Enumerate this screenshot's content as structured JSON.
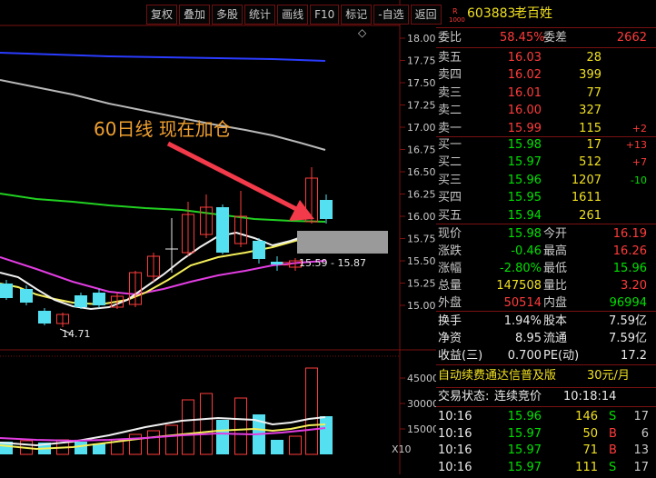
{
  "toolbar": {
    "buttons": [
      "复权",
      "叠加",
      "多股",
      "统计",
      "画线",
      "F10",
      "标记",
      "-自选",
      "返回"
    ]
  },
  "price_axis": [
    "18.00",
    "17.75",
    "17.50",
    "17.25",
    "17.00",
    "16.75",
    "16.50",
    "16.25",
    "16.00",
    "15.75",
    "15.50",
    "15.25",
    "15.00"
  ],
  "volume_axis": [
    "45000",
    "30000",
    "15000"
  ],
  "volume_unit": "X10",
  "chart": {
    "annotation": "60日线  现在加仓",
    "range_label": "15.59 - 15.87",
    "low_label": "14.71",
    "diamond": "◇"
  },
  "stock": {
    "badge_r": "R",
    "badge_num": "1000",
    "code": "603883",
    "name": "老百姓"
  },
  "order_ratio": {
    "label1": "委比",
    "value1": "58.45%",
    "label2": "委差",
    "value2": "2662"
  },
  "asks": [
    {
      "label": "卖五",
      "price": "16.03",
      "vol": "28",
      "chg": ""
    },
    {
      "label": "卖四",
      "price": "16.02",
      "vol": "399",
      "chg": ""
    },
    {
      "label": "卖三",
      "price": "16.01",
      "vol": "77",
      "chg": ""
    },
    {
      "label": "卖二",
      "price": "16.00",
      "vol": "327",
      "chg": ""
    },
    {
      "label": "卖一",
      "price": "15.99",
      "vol": "115",
      "chg": "+2"
    }
  ],
  "bids": [
    {
      "label": "买一",
      "price": "15.98",
      "vol": "17",
      "chg": "+13"
    },
    {
      "label": "买二",
      "price": "15.97",
      "vol": "512",
      "chg": "+7"
    },
    {
      "label": "买三",
      "price": "15.96",
      "vol": "1207",
      "chg": "-10"
    },
    {
      "label": "买四",
      "price": "15.95",
      "vol": "1611",
      "chg": ""
    },
    {
      "label": "买五",
      "price": "15.94",
      "vol": "261",
      "chg": ""
    }
  ],
  "quote": [
    {
      "l1": "现价",
      "v1": "15.98",
      "c1": "green",
      "l2": "今开",
      "v2": "16.19",
      "c2": "red"
    },
    {
      "l1": "涨跌",
      "v1": "-0.46",
      "c1": "green",
      "l2": "最高",
      "v2": "16.26",
      "c2": "red"
    },
    {
      "l1": "涨幅",
      "v1": "-2.80%",
      "c1": "green",
      "l2": "最低",
      "v2": "15.96",
      "c2": "green"
    },
    {
      "l1": "总量",
      "v1": "147508",
      "c1": "yellow",
      "l2": "量比",
      "v2": "3.20",
      "c2": "red"
    },
    {
      "l1": "外盘",
      "v1": "50514",
      "c1": "red",
      "l2": "内盘",
      "v2": "96994",
      "c2": "green"
    }
  ],
  "fundamentals": [
    {
      "l1": "换手",
      "v1": "1.94%",
      "l2": "股本",
      "v2": "7.59亿"
    },
    {
      "l1": "净资",
      "v1": "8.95",
      "l2": "流通",
      "v2": "7.59亿"
    },
    {
      "l1": "收益(三)",
      "v1": "0.700",
      "l2": "PE(动)",
      "v2": "17.2"
    }
  ],
  "ad": {
    "text": "自动续费通达信普及版",
    "price": "30元/月"
  },
  "trade_status": {
    "label": "交易状态:",
    "value": "连续竞价",
    "time": "10:18:14"
  },
  "ticks": [
    {
      "time": "10:16",
      "price": "15.96",
      "vol": "146",
      "side": "S",
      "num": "17"
    },
    {
      "time": "10:16",
      "price": "15.97",
      "vol": "50",
      "side": "B",
      "num": "6"
    },
    {
      "time": "10:16",
      "price": "15.97",
      "vol": "71",
      "side": "B",
      "num": "13"
    },
    {
      "time": "10:16",
      "price": "15.97",
      "vol": "111",
      "side": "S",
      "num": "17"
    }
  ],
  "colors": {
    "up": "#ff3b3b",
    "down": "#00e000",
    "flat": "#c8c8c8",
    "accent": "#f0e020",
    "border": "#7a1111",
    "cyan": "#54e0f0"
  }
}
